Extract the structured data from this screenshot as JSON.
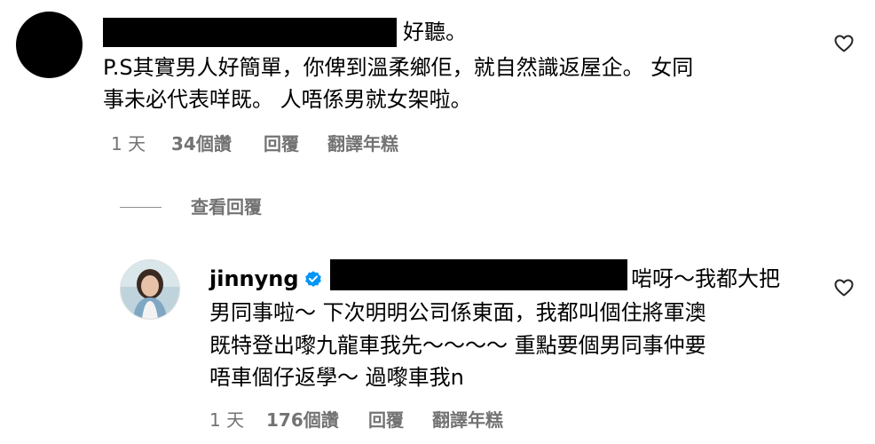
{
  "comment1": {
    "text_after_redaction": "好聽。",
    "line2": "P.S其實男人好簡單，你俾到溫柔鄉佢，就自然識返屋企。 女同",
    "line3": "事未必代表咩既。 人唔係男就女架啦。",
    "time": "1 天",
    "likes": "34個讚",
    "reply_label": "回覆",
    "translate_label": "翻譯年糕"
  },
  "view_replies": {
    "label": "查看回覆"
  },
  "reply1": {
    "username": "jinnyng",
    "text_after_redaction": "啱呀～我都大把",
    "line2": "男同事啦～ 下次明明公司係東面，我都叫個住將軍澳",
    "line3": "既特登出嚟九龍車我先～～～～ 重點要個男同事仲要",
    "line4": "唔車個仔返學～ 過嚟車我n",
    "time": "1 天",
    "likes": "176個讚",
    "reply_label": "回覆",
    "translate_label": "翻譯年糕"
  },
  "colors": {
    "text": "#000000",
    "meta": "#737373",
    "verified_badge": "#0095f6",
    "redaction": "#000000"
  },
  "icons": {
    "like": "heart-outline-icon",
    "verified": "verified-badge-icon"
  }
}
